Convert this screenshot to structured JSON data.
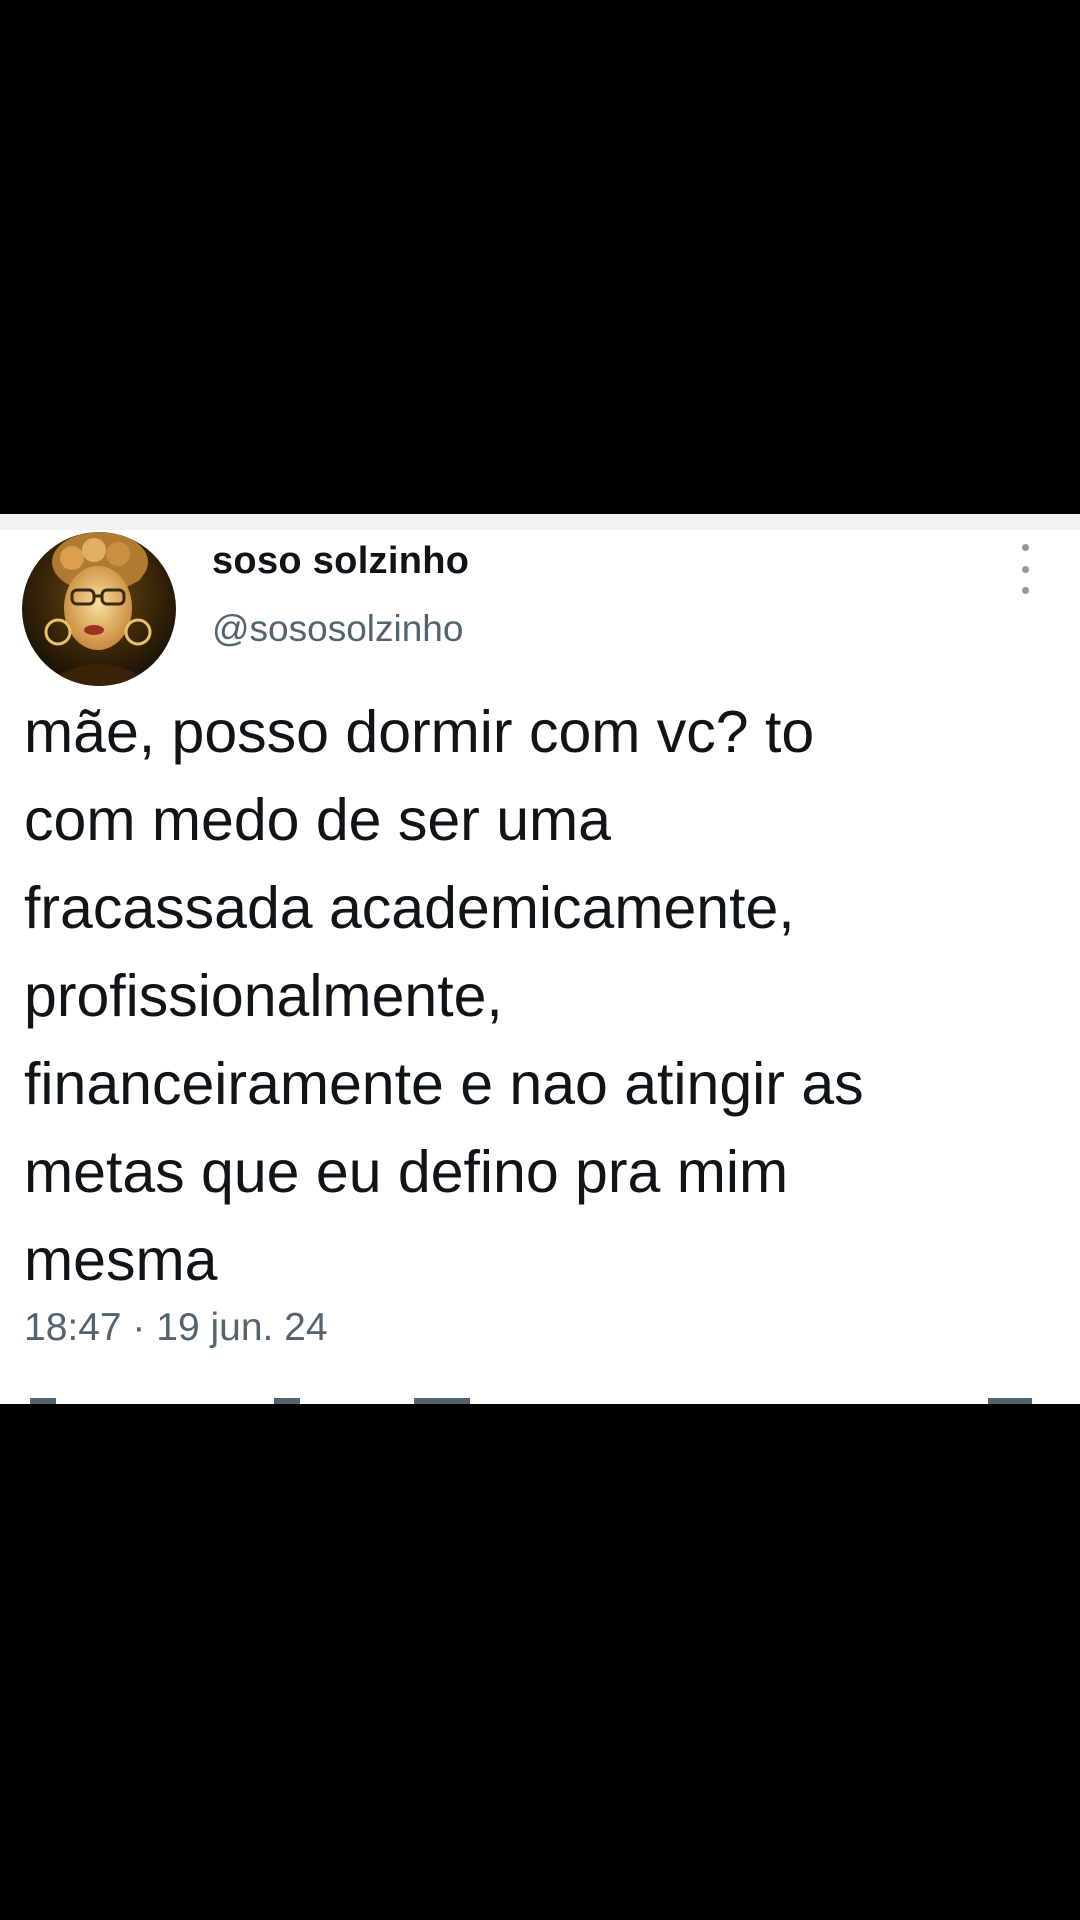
{
  "tweet": {
    "display_name": "soso solzinho",
    "handle": "@sososolzinho",
    "text_lines": [
      "mãe, posso dormir com vc? to",
      "com medo de ser uma",
      "fracassada academicamente,",
      "profissionalmente,",
      "financeiramente e nao atingir as",
      "metas que eu defino pra mim",
      "mesma"
    ],
    "timestamp": "18:47 · 19 jun. 24"
  },
  "icons": {
    "more": "more-options-icon",
    "avatar": "avatar"
  },
  "colors": {
    "background": "#000000",
    "card": "#ffffff",
    "primary_text": "#0f1419",
    "secondary_text": "#536471"
  }
}
